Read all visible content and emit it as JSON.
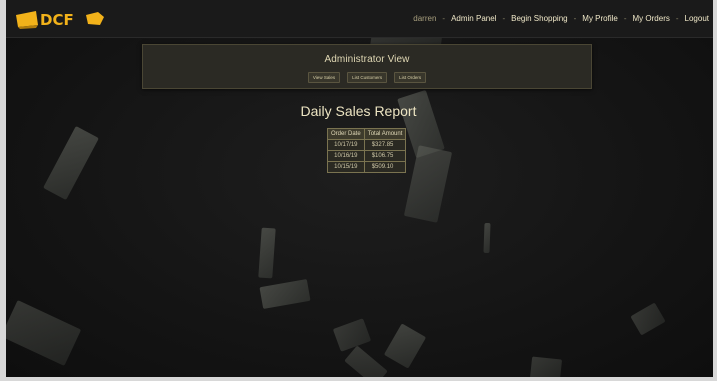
{
  "brand": {
    "logo_text": "DCF",
    "logo_color": "#f2b21a"
  },
  "nav": {
    "username": "darren",
    "items": [
      "Admin Panel",
      "Begin Shopping",
      "My Profile",
      "My Orders",
      "Logout"
    ],
    "separator": "-"
  },
  "admin": {
    "title": "Administrator View",
    "buttons": [
      "View Sales",
      "List Customers",
      "List Orders"
    ]
  },
  "report": {
    "title": "Daily Sales Report",
    "columns": [
      "Order Date",
      "Total Amount"
    ],
    "rows": [
      [
        "10/17/19",
        "$327.85"
      ],
      [
        "10/16/19",
        "$106.75"
      ],
      [
        "10/15/19",
        "$509.10"
      ]
    ]
  },
  "colors": {
    "accent": "#e0d8b4",
    "background": "#121212",
    "panel": "#2b2a24"
  }
}
